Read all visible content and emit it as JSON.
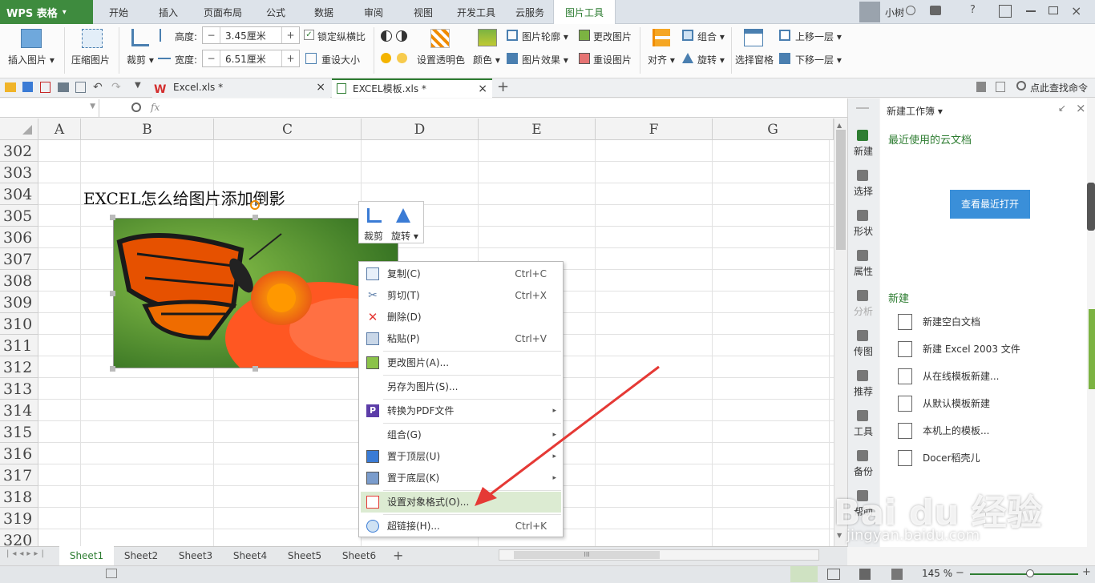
{
  "app": {
    "logo": "WPS 表格",
    "caret": "▾"
  },
  "menu_tabs": [
    "开始",
    "插入",
    "页面布局",
    "公式",
    "数据",
    "审阅",
    "视图",
    "开发工具",
    "云服务",
    "图片工具"
  ],
  "user": {
    "name": "小树",
    "help": "?"
  },
  "ribbon": {
    "insert_picture": "插入图片",
    "compress_picture": "压缩图片",
    "crop": "裁剪",
    "height_label": "高度:",
    "height_value": "3.45厘米",
    "width_label": "宽度:",
    "width_value": "6.51厘米",
    "lock_ratio": "锁定纵横比",
    "reset_size": "重设大小",
    "set_transparent": "设置透明色",
    "color": "颜色",
    "picture_outline": "图片轮廓",
    "picture_effect": "图片效果",
    "change_picture": "更改图片",
    "reset_picture": "重设图片",
    "align": "对齐",
    "group": "组合",
    "rotate": "旋转",
    "selection_pane": "选择窗格",
    "bring_forward": "上移一层",
    "send_backward": "下移一层",
    "minus": "−",
    "plus": "+"
  },
  "doc_tabs": [
    {
      "name": "Excel.xls *",
      "close": "×"
    },
    {
      "name": "EXCEL模板.xls *",
      "close": "×"
    }
  ],
  "search_command": "点此查找命令",
  "formula": {
    "fx": "fx"
  },
  "columns": [
    "A",
    "B",
    "C",
    "D",
    "E",
    "F",
    "G"
  ],
  "rows": [
    "302",
    "303",
    "304",
    "305",
    "306",
    "307",
    "308",
    "309",
    "310",
    "311",
    "312",
    "313",
    "314",
    "315",
    "316",
    "317",
    "318",
    "319",
    "320"
  ],
  "cell_text": "EXCEL怎么给图片添加倒影",
  "mini_toolbar": {
    "crop": "裁剪",
    "rotate": "旋转"
  },
  "context_menu": [
    {
      "label": "复制(C)",
      "shortcut": "Ctrl+C",
      "icon": "copy-icon"
    },
    {
      "label": "剪切(T)",
      "shortcut": "Ctrl+X",
      "icon": "scissors-icon"
    },
    {
      "label": "删除(D)",
      "shortcut": "",
      "icon": "delete-icon"
    },
    {
      "label": "粘贴(P)",
      "shortcut": "Ctrl+V",
      "icon": "paste-icon"
    },
    {
      "label": "更改图片(A)...",
      "shortcut": "",
      "icon": "change-picture-icon"
    },
    {
      "label": "另存为图片(S)...",
      "shortcut": "",
      "icon": ""
    },
    {
      "label": "转换为PDF文件",
      "shortcut": "",
      "icon": "pdf-icon"
    },
    {
      "label": "组合(G)",
      "shortcut": "",
      "icon": ""
    },
    {
      "label": "置于顶层(U)",
      "shortcut": "",
      "icon": "bring-to-front-icon"
    },
    {
      "label": "置于底层(K)",
      "shortcut": "",
      "icon": "send-to-back-icon"
    },
    {
      "label": "设置对象格式(O)...",
      "shortcut": "",
      "icon": "format-object-icon"
    },
    {
      "label": "超链接(H)...",
      "shortcut": "Ctrl+K",
      "icon": "hyperlink-icon"
    }
  ],
  "side_nav": [
    "新建",
    "选择",
    "形状",
    "属性",
    "分析",
    "传图",
    "推荐",
    "工具",
    "备份",
    "帮助"
  ],
  "panel": {
    "title": "新建工作簿 ▾",
    "recent_cloud": "最近使用的云文档",
    "view_recent": "查看最近打开",
    "new_header": "新建",
    "new_items": [
      "新建空白文档",
      "新建 Excel 2003 文件",
      "从在线模板新建...",
      "从默认模板新建",
      "本机上的模板...",
      "Docer稻壳儿"
    ]
  },
  "sheet_tabs": [
    "Sheet1",
    "Sheet2",
    "Sheet3",
    "Sheet4",
    "Sheet5",
    "Sheet6"
  ],
  "status": {
    "zoom": "145 %",
    "scroll_mark": "III"
  },
  "watermark": {
    "brand": "Bai du 经验",
    "url": "jingyan.baidu.com"
  },
  "colors": {
    "accent": "#2e7d32",
    "menu_highlight": "#dcebd2",
    "arrow": "#e53935"
  }
}
